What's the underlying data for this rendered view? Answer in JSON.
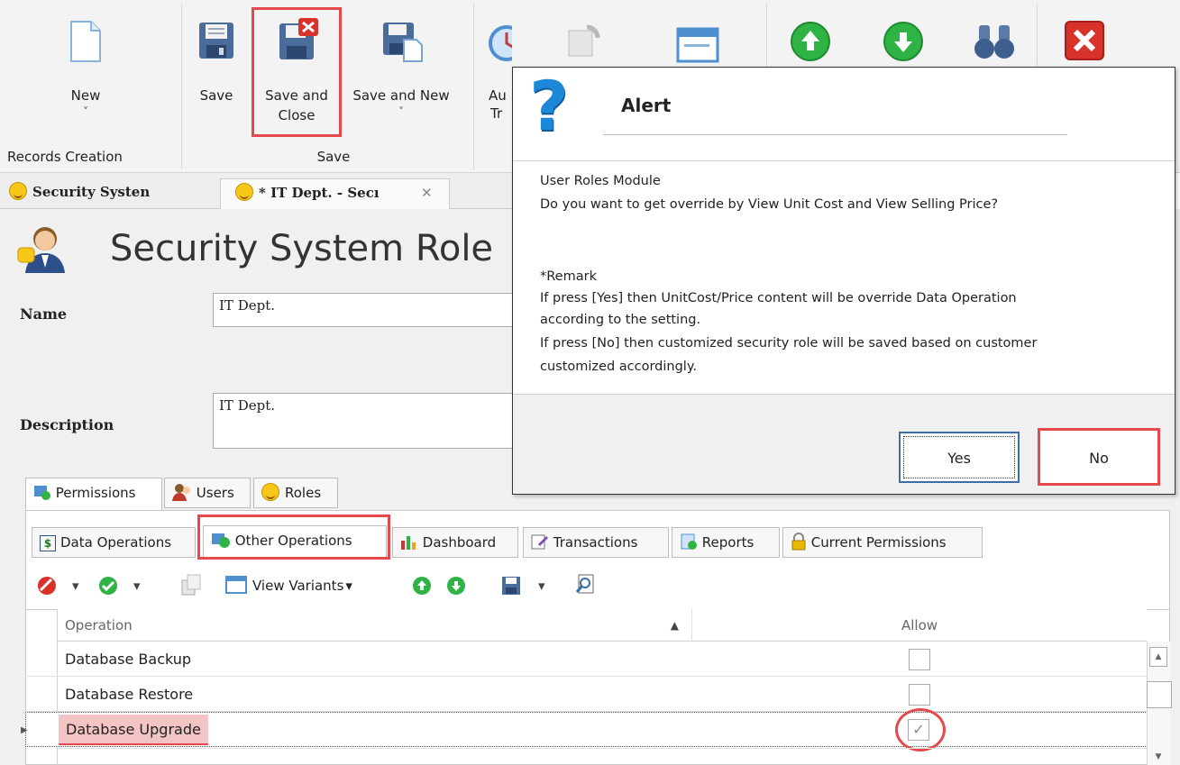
{
  "ribbon": {
    "new_label": "New",
    "save_label": "Save",
    "save_close_line1": "Save and",
    "save_close_line2": "Close",
    "save_new_label": "Save and New",
    "audit_line1": "Au",
    "audit_line2": "Tr",
    "group_records": "Records Creation",
    "group_save": "Save",
    "dropdown_glyph": "˅"
  },
  "doc_tabs": [
    {
      "label": "Security Systen"
    },
    {
      "label": "* IT Dept. - Secı"
    }
  ],
  "tab_close_glyph": "✕",
  "page": {
    "title": "Security System Role"
  },
  "form": {
    "name_label": "Name",
    "name_value": "IT Dept.",
    "description_label": "Description",
    "description_value": "IT Dept."
  },
  "outer_tabs": [
    {
      "label": "Permissions"
    },
    {
      "label": "Users"
    },
    {
      "label": "Roles"
    }
  ],
  "inner_tabs": [
    {
      "label": "Data Operations"
    },
    {
      "label": "Other Operations"
    },
    {
      "label": "Dashboard"
    },
    {
      "label": "Transactions"
    },
    {
      "label": "Reports"
    },
    {
      "label": "Current Permissions"
    }
  ],
  "toolbar": {
    "view_variants_label": "View Variants",
    "dropdown_glyph": "▾"
  },
  "grid": {
    "columns": {
      "operation": "Operation",
      "allow": "Allow"
    },
    "sort_glyph": "▲",
    "row_indicator_glyph": "▶",
    "rows": [
      {
        "operation": "Database Backup",
        "allow": false
      },
      {
        "operation": "Database Restore",
        "allow": false
      },
      {
        "operation": "Database Upgrade",
        "allow": true
      }
    ],
    "scroll_up_glyph": "▲",
    "scroll_down_glyph": "▼"
  },
  "dialog": {
    "title": "Alert",
    "icon_glyph": "?",
    "line1": "User Roles Module",
    "line2": "Do you want to get override by View Unit Cost and View Selling Price?",
    "remark_heading": "*Remark",
    "remark1": "If press [Yes] then UnitCost/Price content will be override Data Operation",
    "remark2": "according to the setting.",
    "remark3": "If press [No] then customized security role will be saved based on customer",
    "remark4": "customized accordingly.",
    "yes_label": "Yes",
    "no_label": "No"
  },
  "colors": {
    "highlight_red": "#e5484d",
    "green_icon": "#2fb344",
    "close_red": "#d9322b",
    "question_blue": "#1e88d8"
  }
}
